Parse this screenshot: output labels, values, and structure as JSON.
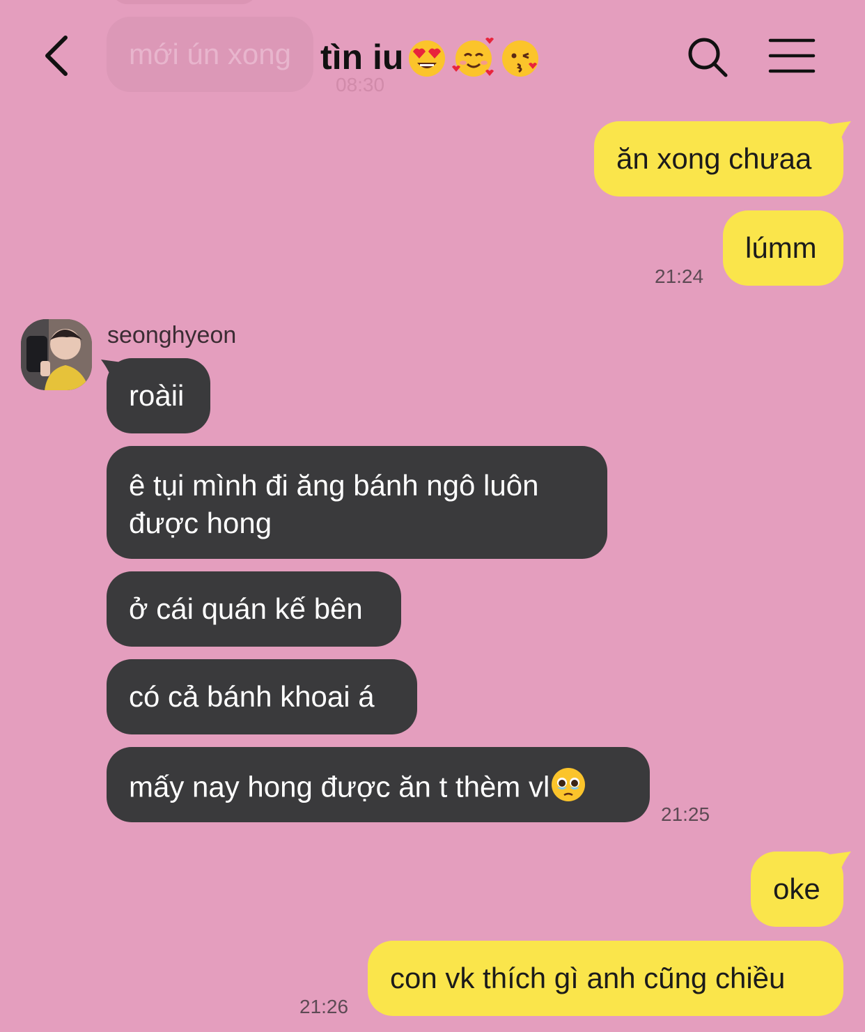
{
  "header": {
    "title": "tìn iu",
    "title_emojis": [
      "heart-eyes-emoji",
      "smiling-hearts-emoji",
      "kissing-heart-emoji"
    ]
  },
  "background_color": "#e49ebe",
  "outgoing_color": "#fae54b",
  "incoming_color": "#3a3a3c",
  "previous": {
    "message": "mới ún xong",
    "time": "08:30"
  },
  "messages": [
    {
      "direction": "out",
      "text": "ăn xong chưaa"
    },
    {
      "direction": "out",
      "text": "lúmm",
      "time": "21:24"
    },
    {
      "direction": "in",
      "sender": "seonghyeon",
      "text": "roàii"
    },
    {
      "direction": "in",
      "text_line1": "ê tụi mình đi ăng bánh ngô luôn",
      "text_line2": "được hong"
    },
    {
      "direction": "in",
      "text": "ở cái quán kế bên"
    },
    {
      "direction": "in",
      "text": "có cả bánh khoai á"
    },
    {
      "direction": "in",
      "text": "mấy nay hong được ăn t thèm vl",
      "emoji": "pleading-face-emoji",
      "time": "21:25"
    },
    {
      "direction": "out",
      "text": "oke"
    },
    {
      "direction": "out",
      "text": "con vk thích gì anh cũng chiều",
      "time": "21:26"
    }
  ]
}
